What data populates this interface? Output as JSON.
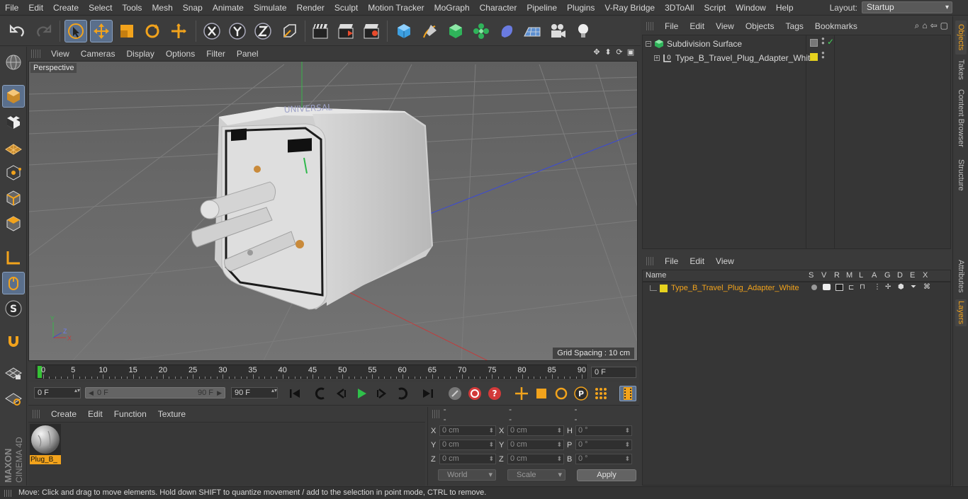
{
  "menubar": {
    "items": [
      "File",
      "Edit",
      "Create",
      "Select",
      "Tools",
      "Mesh",
      "Snap",
      "Animate",
      "Simulate",
      "Render",
      "Sculpt",
      "Motion Tracker",
      "MoGraph",
      "Character",
      "Pipeline",
      "Plugins",
      "V-Ray Bridge",
      "3DToAll",
      "Script",
      "Window",
      "Help"
    ],
    "layout_label": "Layout:",
    "layout_value": "Startup"
  },
  "viewport": {
    "menu": [
      "View",
      "Cameras",
      "Display",
      "Options",
      "Filter",
      "Panel"
    ],
    "label": "Perspective",
    "grid_spacing": "Grid Spacing : 10 cm",
    "axis_labels": {
      "y": "Y",
      "x": "X",
      "z": "Z"
    }
  },
  "timeline": {
    "ticks": [
      0,
      5,
      10,
      15,
      20,
      25,
      30,
      35,
      40,
      45,
      50,
      55,
      60,
      65,
      70,
      75,
      80,
      85,
      90
    ],
    "current_frame": "0 F",
    "start_field": "0 F",
    "range_start": "0 F",
    "range_end": "90 F",
    "end_field": "90 F"
  },
  "material_manager": {
    "menu": [
      "Create",
      "Edit",
      "Function",
      "Texture"
    ],
    "material_name": "Plug_B_"
  },
  "coordinates": {
    "headers": [
      "--",
      "--",
      "--"
    ],
    "rows": [
      {
        "l1": "X",
        "v1": "0 cm",
        "l2": "X",
        "v2": "0 cm",
        "l3": "H",
        "v3": "0 °"
      },
      {
        "l1": "Y",
        "v1": "0 cm",
        "l2": "Y",
        "v2": "0 cm",
        "l3": "P",
        "v3": "0 °"
      },
      {
        "l1": "Z",
        "v1": "0 cm",
        "l2": "Z",
        "v2": "0 cm",
        "l3": "B",
        "v3": "0 °"
      }
    ],
    "space": "World",
    "mode": "Scale",
    "apply": "Apply"
  },
  "object_manager": {
    "menu": [
      "File",
      "Edit",
      "View",
      "Objects",
      "Tags",
      "Bookmarks"
    ],
    "objects": [
      {
        "name": "Subdivision Surface"
      },
      {
        "name": "Type_B_Travel_Plug_Adapter_White"
      }
    ]
  },
  "layer_manager": {
    "menu": [
      "File",
      "Edit",
      "View"
    ],
    "columns": [
      "Name",
      "S",
      "V",
      "R",
      "M",
      "L",
      "A",
      "G",
      "D",
      "E",
      "X"
    ],
    "layers": [
      {
        "name": "Type_B_Travel_Plug_Adapter_White",
        "color": "#e6d21e"
      }
    ]
  },
  "right_tabs": [
    "Objects",
    "Takes",
    "Content Browser",
    "Structure",
    "Attributes",
    "Layers"
  ],
  "status": "Move: Click and drag to move elements. Hold down SHIFT to quantize movement / add to the selection in point mode, CTRL to remove.",
  "colors": {
    "accent": "#f2a31c",
    "selected_tool": "#5a6f8c",
    "timeline_cursor": "#35c135"
  }
}
